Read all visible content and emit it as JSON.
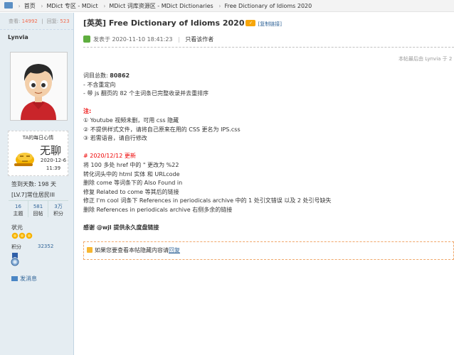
{
  "breadcrumb": [
    "首页",
    "MDict 专区 - MDict",
    "MDict 词库资源区 - MDict Dictionaries",
    "Free Dictionary of Idioms 2020"
  ],
  "sidebar": {
    "stats": {
      "views_label": "查看:",
      "views": "14992",
      "replies_label": "回复:",
      "replies": "523"
    },
    "username": "Lynvia",
    "mood": {
      "title": "TA的每日心情",
      "word": "无聊",
      "date": "2020-12-6",
      "time": "11:39"
    },
    "sign_days": "签到天数: 198 天",
    "rank": "[LV.7]常住居民III",
    "counts": [
      {
        "value": "16",
        "label": "主题"
      },
      {
        "value": "581",
        "label": "回帖"
      },
      {
        "value": "3万",
        "label": "积分"
      }
    ],
    "status_label": "状元",
    "points_label": "积分",
    "points_value": "32352",
    "send_message": "发消息"
  },
  "post": {
    "title": "[英英] Free Dictionary of Idioms 2020",
    "copy_link": "[复制链接]",
    "posted_at": "发表于 2020-11-10 18:41:23",
    "author_only": "只看该作者",
    "edited": "本帖最后由 Lynvia 于 2",
    "body": {
      "count_label": "词目总数:",
      "count_value": "80862",
      "lines1": [
        "- 不含重定向",
        "- 带 js 翻页的 82 个主词条已完整收录并去重排序"
      ],
      "note_title": "注:",
      "notes": [
        "① Youtube 视频未删，可用 css 隐藏",
        "② 不提供样式文件，请将自己原来在用的 CSS 更名为 IPS.css",
        "③ 若需语音，请自行修改"
      ],
      "update_title": "# 2020/12/12 更新",
      "updates": [
        "将 100 多处 href 中的 \" 更改为 %22",
        "转化词头中的 html 实体 和 URLcode",
        "删除 come 等词条下的 Also Found in",
        "修复 Related to come 等其后的链接",
        "修正 I'm cool 词条下 References in periodicals archive 中的 1 处引文错误 以及 2 处引号缺失",
        "删除 References in periodicals archive 右侧多余的链接"
      ],
      "thanks": "感谢 @wjl 提供永久度盘链接"
    },
    "hidden_notice": "如果您要查看本帖隐藏内容请",
    "hidden_link": "回复"
  }
}
